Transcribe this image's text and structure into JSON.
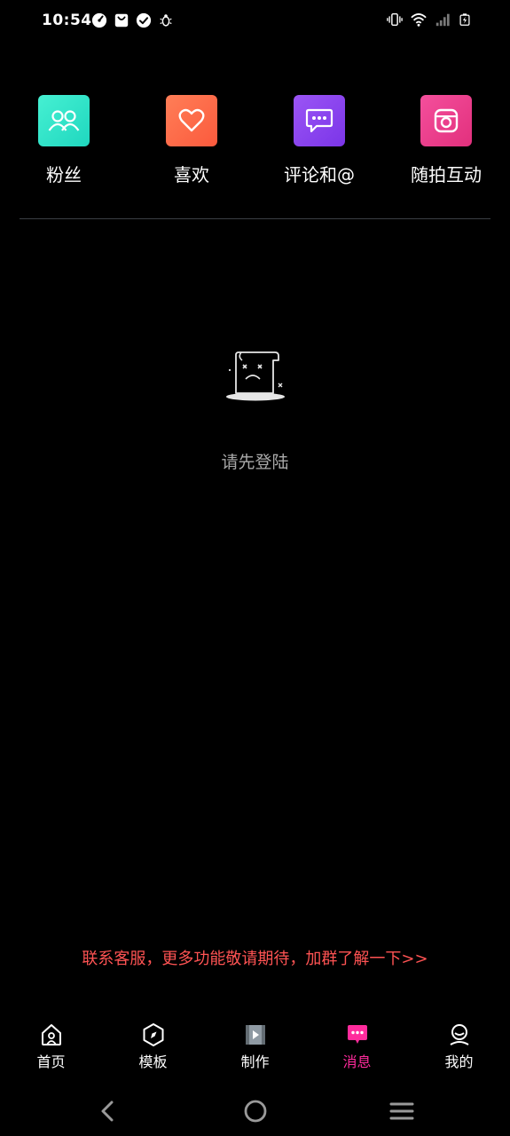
{
  "status_bar": {
    "time": "10:54",
    "left_icons": [
      "speedometer-icon",
      "shopping-bag-icon",
      "check-circle-icon",
      "bug-icon"
    ],
    "right_icons": [
      "vibrate-icon",
      "wifi-icon",
      "cellular-signal-icon",
      "battery-charging-icon"
    ]
  },
  "quick_actions": [
    {
      "label": "粉丝",
      "icon": "users-icon",
      "color": "#33e6c6"
    },
    {
      "label": "喜欢",
      "icon": "heart-icon",
      "color": "#ff6d4a"
    },
    {
      "label": "评论和@",
      "icon": "comment-icon",
      "color": "#8a47f0"
    },
    {
      "label": "随拍互动",
      "icon": "camera-icon",
      "color": "#ee3d8c"
    }
  ],
  "empty_state": {
    "message": "请先登陆",
    "icon": "sad-document-icon"
  },
  "promo": {
    "text": "联系客服，更多功能敬请期待，加群了解一下>>",
    "color": "#ff5353"
  },
  "tabs": [
    {
      "label": "首页",
      "icon": "home-icon",
      "active": false
    },
    {
      "label": "模板",
      "icon": "compass-icon",
      "active": false
    },
    {
      "label": "制作",
      "icon": "video-icon",
      "active": false
    },
    {
      "label": "消息",
      "icon": "message-icon",
      "active": true
    },
    {
      "label": "我的",
      "icon": "profile-icon",
      "active": false
    }
  ],
  "accent_color": "#ff2b9c"
}
